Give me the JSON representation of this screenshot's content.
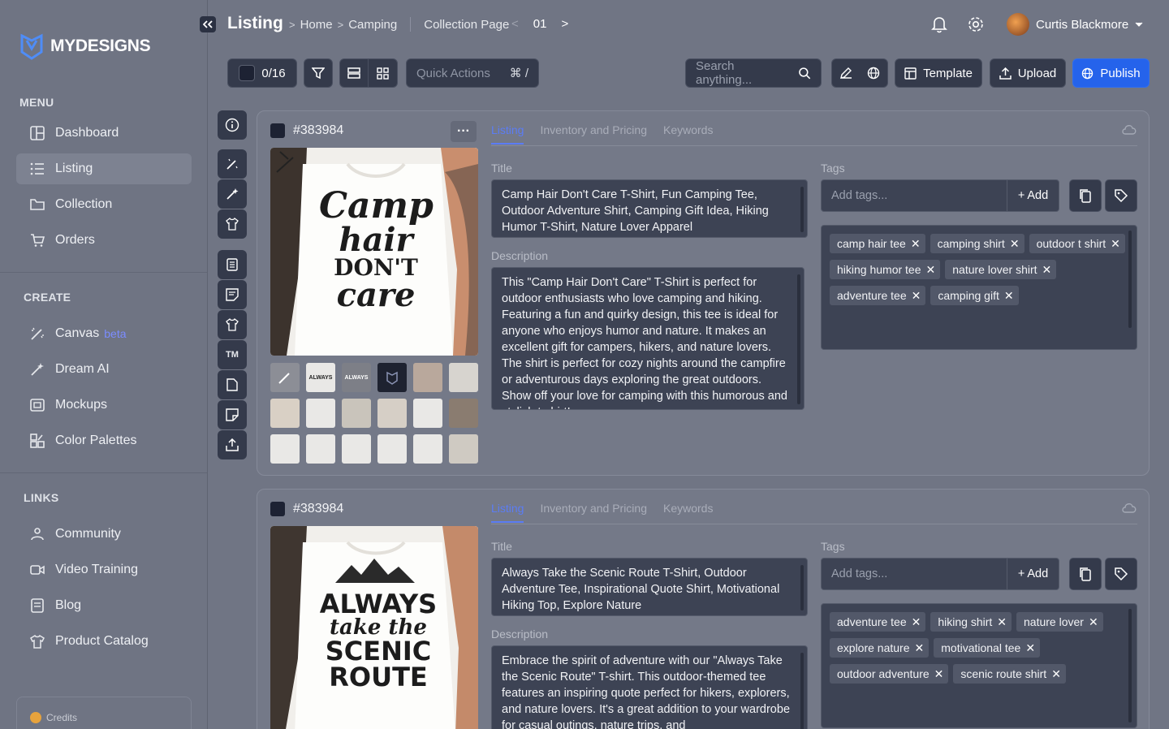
{
  "app": {
    "brand": "MYDESIGNS"
  },
  "sidebar": {
    "menu_label": "MENU",
    "menu": [
      {
        "label": "Dashboard",
        "icon": "dashboard-icon"
      },
      {
        "label": "Listing",
        "icon": "list-icon",
        "active": true
      },
      {
        "label": "Collection",
        "icon": "folder-icon"
      },
      {
        "label": "Orders",
        "icon": "cart-icon"
      }
    ],
    "create_label": "CREATE",
    "create": [
      {
        "label": "Canvas",
        "badge": "beta",
        "icon": "wand-icon"
      },
      {
        "label": "Dream AI",
        "icon": "magic-icon"
      },
      {
        "label": "Mockups",
        "icon": "mockup-icon"
      },
      {
        "label": "Color Palettes",
        "icon": "palette-icon"
      }
    ],
    "links_label": "LINKS",
    "links": [
      {
        "label": "Community",
        "icon": "community-icon"
      },
      {
        "label": "Video Training",
        "icon": "video-icon"
      },
      {
        "label": "Blog",
        "icon": "blog-icon"
      },
      {
        "label": "Product Catalog",
        "icon": "shirt-icon"
      }
    ],
    "credits_label": "Credits"
  },
  "header": {
    "title": "Listing",
    "breadcrumbs": [
      "Home",
      "Camping"
    ],
    "collection_page": "Collection Page",
    "page_number": "01",
    "user_name": "Curtis Blackmore"
  },
  "toolbar": {
    "selected_count": "0/16",
    "quick_actions": "Quick Actions",
    "quick_shortcut": "⌘ /",
    "search_placeholder": "Search anything...",
    "template": "Template",
    "upload": "Upload",
    "publish": "Publish"
  },
  "rail": {
    "tm_label": "TM"
  },
  "listings": [
    {
      "id": "#383984",
      "tabs": [
        "Listing",
        "Inventory and Pricing",
        "Keywords"
      ],
      "title_label": "Title",
      "title": "Camp Hair Don't Care T-Shirt, Fun Camping Tee, Outdoor Adventure Shirt, Camping Gift Idea, Hiking Humor T-Shirt, Nature Lover Apparel",
      "description_label": "Description",
      "description": "This \"Camp Hair Don't Care\" T-Shirt is perfect for outdoor enthusiasts who love camping and hiking. Featuring a fun and quirky design, this tee is ideal for anyone who enjoys humor and nature. It makes an excellent gift for campers, hikers, and nature lovers. The shirt is perfect for cozy nights around the campfire or adventurous days exploring the great outdoors. Show off your love for camping with this humorous and stylish t-shirt!",
      "tags_label": "Tags",
      "tags_placeholder": "Add tags...",
      "add_label": "Add",
      "tags": [
        "camp hair tee",
        "camping shirt",
        "outdoor t shirt",
        "hiking humor tee",
        "nature lover shirt",
        "adventure tee",
        "camping gift"
      ],
      "design_lines": [
        "Camp",
        "hair",
        "DON'T",
        "care"
      ]
    },
    {
      "id": "#383984",
      "tabs": [
        "Listing",
        "Inventory and Pricing",
        "Keywords"
      ],
      "title_label": "Title",
      "title": "Always Take the Scenic Route T-Shirt, Outdoor Adventure Tee, Inspirational Quote Shirt, Motivational Hiking Top, Explore Nature",
      "description_label": "Description",
      "description": "Embrace the spirit of adventure with our \"Always Take the Scenic Route\" T-shirt. This outdoor-themed tee features an inspiring quote perfect for hikers, explorers, and nature lovers. It's a great addition to your wardrobe for casual outings, nature trips, and",
      "tags_label": "Tags",
      "tags_placeholder": "Add tags...",
      "add_label": "Add",
      "tags": [
        "adventure tee",
        "hiking shirt",
        "nature lover",
        "explore nature",
        "motivational tee",
        "outdoor adventure",
        "scenic route shirt"
      ],
      "design_lines": [
        "ALWAYS",
        "take the",
        "SCENIC",
        "ROUTE"
      ]
    }
  ],
  "thumbnail_labels": [
    "ALWAYS",
    "ALWAYS"
  ],
  "colors": {
    "accent": "#2563eb",
    "tab_active": "#5b7cf5",
    "sidebar_bg": "#6f7483",
    "panel_bg": "#3d4354"
  }
}
